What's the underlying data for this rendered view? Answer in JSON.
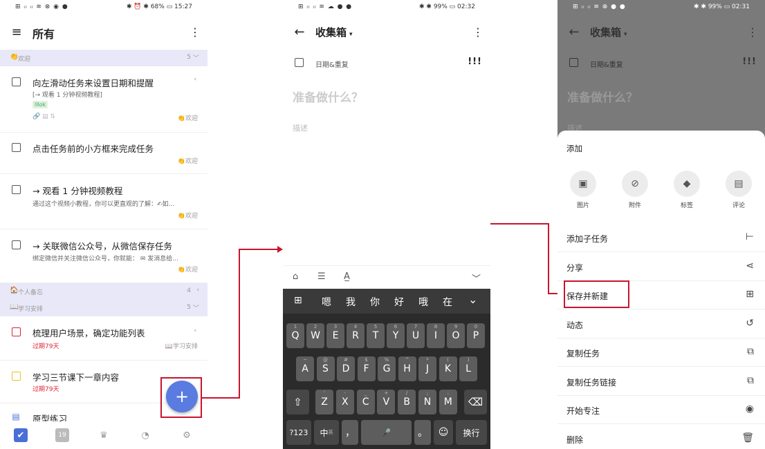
{
  "panel1": {
    "status_left": "⊞ ᵢₗ ᵢₗ ≋ ⊗ ◉ ●",
    "status_right": "✱ ⏰ ✱ 68% ▭ 15:27",
    "title": "所有",
    "sections": [
      {
        "emoji": "👏",
        "name": "欢迎",
        "count": "5",
        "arrow": "﹀"
      },
      {
        "emoji": "🏠",
        "name": "个人备忘",
        "count": "4",
        "arrow": "‹"
      },
      {
        "emoji": "📖",
        "name": "学习安排",
        "count": "5",
        "arrow": "﹀"
      }
    ],
    "tasks": [
      {
        "title": "向左滑动任务来设置日期和提醒",
        "sub": "[→ 观看 1 分钟视频教程]",
        "tag": "lllok",
        "icons": "🔗 ▤ ⇅",
        "list": "👏欢迎",
        "arrow": "‹"
      },
      {
        "title": "点击任务前的小方框来完成任务",
        "list": "👏欢迎"
      },
      {
        "title": "→ 观看 1 分钟视频教程",
        "sub": "通过这个视频小教程，你可以更直观的了解：✍如...",
        "list": "👏欢迎"
      },
      {
        "title": "→ 关联微信公众号，从微信保存任务",
        "sub": "绑定微信并关注微信公众号，你就能： ✉ 发消息给...",
        "list": "👏欢迎"
      },
      {
        "title": "梳理用户场景，确定功能列表",
        "sub": "过期79天",
        "list": "📖学习安排",
        "arrow": "‹"
      },
      {
        "title": "学习三节课下一章内容",
        "sub": "过期79天"
      },
      {
        "title": "原型练习"
      }
    ],
    "fab": "+",
    "tabs": [
      "✔",
      "19",
      "♛",
      "◔",
      "⚙"
    ]
  },
  "panel2": {
    "status_left": "⊞ ᵢₗ ᵢₗ ≋ ☁ ● ●",
    "status_right": "✱ ✱ 99% ▭ 02:32",
    "title": "收集箱",
    "dropdown": "▾",
    "date_repeat": "日期&重复",
    "priority": "!!!",
    "placeholder_title": "准备做什么？",
    "placeholder_desc": "描述",
    "tools": [
      "⌂",
      "☰",
      "A̲",
      "﹀"
    ],
    "candidates": [
      "嗯",
      "我",
      "你",
      "好",
      "哦",
      "在"
    ],
    "row1": [
      {
        "k": "Q",
        "s": "1"
      },
      {
        "k": "W",
        "s": "2"
      },
      {
        "k": "E",
        "s": "3"
      },
      {
        "k": "R",
        "s": "4"
      },
      {
        "k": "T",
        "s": "5"
      },
      {
        "k": "Y",
        "s": "6"
      },
      {
        "k": "U",
        "s": "7"
      },
      {
        "k": "I",
        "s": "8"
      },
      {
        "k": "O",
        "s": "9"
      },
      {
        "k": "P",
        "s": "0"
      }
    ],
    "row2": [
      {
        "k": "A",
        "s": "~"
      },
      {
        "k": "S",
        "s": "@"
      },
      {
        "k": "D",
        "s": "#"
      },
      {
        "k": "F",
        "s": "$"
      },
      {
        "k": "G",
        "s": "%"
      },
      {
        "k": "H",
        "s": "^"
      },
      {
        "k": "J",
        "s": "*"
      },
      {
        "k": "K",
        "s": "("
      },
      {
        "k": "L",
        "s": ")"
      }
    ],
    "row3": [
      {
        "k": "Z",
        "s": "'"
      },
      {
        "k": "X",
        "s": "-"
      },
      {
        "k": "C",
        "s": "_"
      },
      {
        "k": "V",
        "s": "+"
      },
      {
        "k": "B",
        "s": "/"
      },
      {
        "k": "N",
        "s": ";"
      },
      {
        "k": "M",
        "s": ":"
      }
    ],
    "shift": "⇧",
    "backspace": "⌫",
    "num": "?123",
    "lang": "中",
    "lang_sub": "英",
    "comma": "，",
    "period": "。",
    "emoji": "☺",
    "enter": "换行",
    "mic": "🎤",
    "grid": "⊞",
    "collapse": "⌄"
  },
  "panel3": {
    "status_left": "⊞ ᵢₗ ᵢₗ ≋ ⊗ ● ●",
    "status_right": "✱ ✱ 99% ▭ 02:31",
    "title": "收集箱",
    "date_repeat": "日期&重复",
    "priority": "!!!",
    "placeholder_title": "准备做什么？",
    "placeholder_desc": "描述",
    "sheet_title": "添加",
    "circles": [
      {
        "icon": "▣",
        "label": "图片"
      },
      {
        "icon": "⊘",
        "label": "附件"
      },
      {
        "icon": "◆",
        "label": "标签"
      },
      {
        "icon": "▤",
        "label": "评论"
      }
    ],
    "menu": [
      {
        "label": "添加子任务",
        "icon": "⊢"
      },
      {
        "label": "分享",
        "icon": "⋖"
      },
      {
        "label": "保存并新建",
        "icon": "⊞"
      },
      {
        "label": "动态",
        "icon": "↺"
      },
      {
        "label": "复制任务",
        "icon": "⧉"
      },
      {
        "label": "复制任务链接",
        "icon": "⧉"
      },
      {
        "label": "开始专注",
        "icon": "◉"
      },
      {
        "label": "删除",
        "icon": "🗑"
      }
    ]
  }
}
